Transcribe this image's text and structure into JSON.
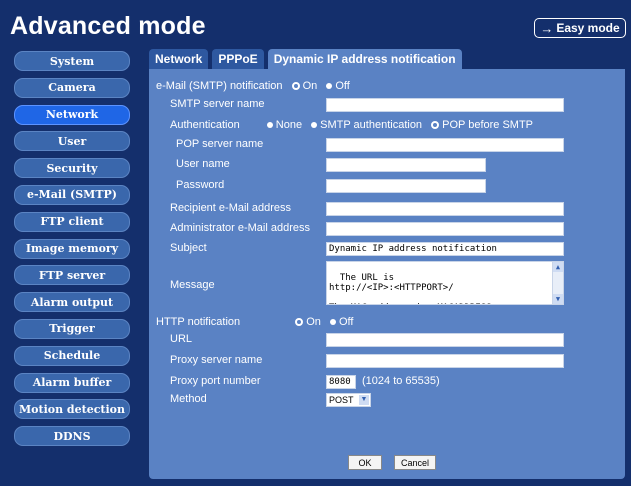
{
  "header": {
    "title": "Advanced mode",
    "easy_mode_label": "Easy mode"
  },
  "sidebar": {
    "items": [
      {
        "label": "System"
      },
      {
        "label": "Camera"
      },
      {
        "label": "Network"
      },
      {
        "label": "User"
      },
      {
        "label": "Security"
      },
      {
        "label": "e-Mail (SMTP)"
      },
      {
        "label": "FTP client"
      },
      {
        "label": "Image memory"
      },
      {
        "label": "FTP server"
      },
      {
        "label": "Alarm output"
      },
      {
        "label": "Trigger"
      },
      {
        "label": "Schedule"
      },
      {
        "label": "Alarm buffer"
      },
      {
        "label": "Motion detection"
      },
      {
        "label": "DDNS"
      }
    ],
    "active": "Network"
  },
  "tabs": [
    {
      "label": "Network"
    },
    {
      "label": "PPPoE"
    },
    {
      "label": "Dynamic IP address notification"
    }
  ],
  "form": {
    "smtp_notification_label": "e-Mail (SMTP) notification",
    "on_label": "On",
    "off_label": "Off",
    "smtp_server_name_label": "SMTP server name",
    "smtp_server_name_value": "",
    "authentication_label": "Authentication",
    "auth_none": "None",
    "auth_smtp": "SMTP authentication",
    "auth_pop": "POP before SMTP",
    "auth_selected": "POP before SMTP",
    "pop_server_name_label": "POP server name",
    "user_name_label": "User name",
    "password_label": "Password",
    "recipient_label": "Recipient e-Mail address",
    "administrator_label": "Administrator e-Mail address",
    "subject_label": "Subject",
    "subject_value": "Dynamic IP address notification",
    "message_label": "Message",
    "message_value": "The URL is\nhttp://<IP>:<HTTPPORT>/\n\nThe MAC address is <MACADDRESS>.",
    "http_notification_label": "HTTP notification",
    "url_label": "URL",
    "proxy_server_name_label": "Proxy server name",
    "proxy_port_label": "Proxy port number",
    "proxy_port_value": "8080",
    "proxy_port_range": "(1024 to 65535)",
    "method_label": "Method",
    "method_value": "POST",
    "ok_label": "OK",
    "cancel_label": "Cancel",
    "smtp_state": "On",
    "http_state": "On"
  },
  "colors": {
    "background": "#142f6c",
    "panel": "#5a82c4",
    "sidebar_button": "#3a67ac",
    "sidebar_active": "#1f66e6"
  }
}
